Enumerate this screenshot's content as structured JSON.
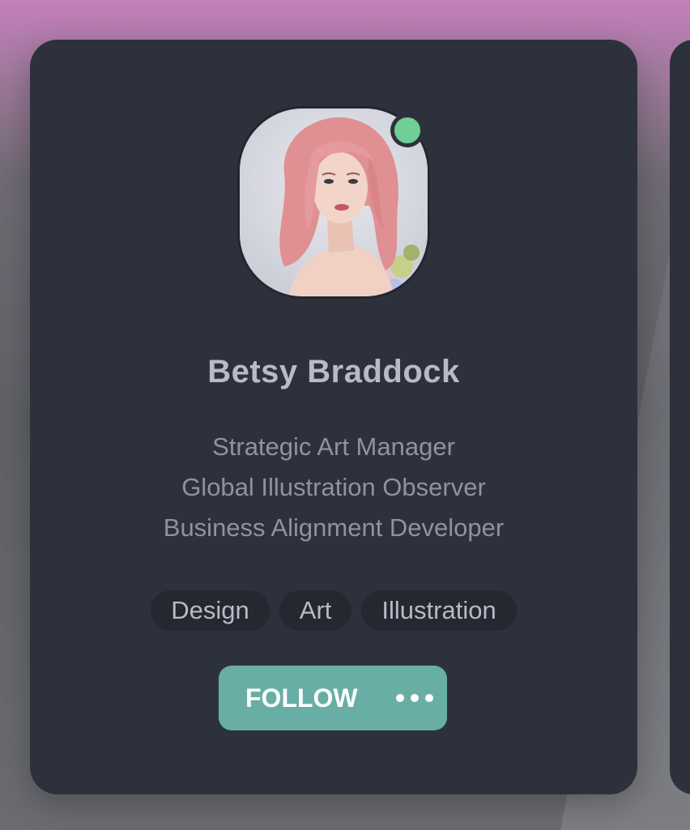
{
  "profile": {
    "name": "Betsy Braddock",
    "status": "online",
    "roles": [
      "Strategic Art Manager",
      "Global Illustration Observer",
      "Business Alignment Developer"
    ],
    "tags": [
      "Design",
      "Art",
      "Illustration"
    ],
    "actions": {
      "follow_label": "FOLLOW",
      "more_icon": "more-dots-icon"
    }
  },
  "colors": {
    "card_bg": "#2d313c",
    "accent": "#68aea4",
    "status_online": "#6fcf97",
    "tag_bg": "#252830"
  }
}
